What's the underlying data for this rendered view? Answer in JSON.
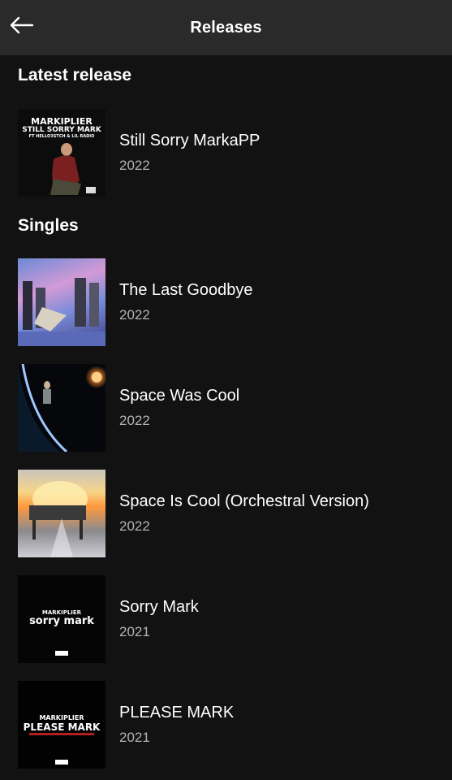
{
  "header": {
    "title": "Releases"
  },
  "latest": {
    "section_title": "Latest release",
    "item": {
      "title": "Still Sorry MarkaPP",
      "year": "2022",
      "cover": {
        "line1": "MARKIPLIER",
        "line2": "STILL SORRY MARK",
        "line3": "FT HELLO3STCH & LIL RADIO"
      }
    }
  },
  "singles": {
    "section_title": "Singles",
    "items": [
      {
        "title": "The Last Goodbye",
        "year": "2022"
      },
      {
        "title": "Space Was Cool",
        "year": "2022"
      },
      {
        "title": "Space Is Cool (Orchestral Version)",
        "year": "2022"
      },
      {
        "title": "Sorry Mark",
        "year": "2021",
        "cover": {
          "line1": "MARKIPLIER",
          "line2": "sorry mark"
        }
      },
      {
        "title": "PLEASE MARK",
        "year": "2021",
        "cover": {
          "line1": "MARKIPLIER",
          "line2": "PLEASE MARK"
        }
      }
    ]
  },
  "colors": {
    "background": "#121212",
    "header": "#2a2a2a",
    "subtext": "#b3b3b3"
  },
  "icons": {
    "back": "arrow-left-icon"
  }
}
